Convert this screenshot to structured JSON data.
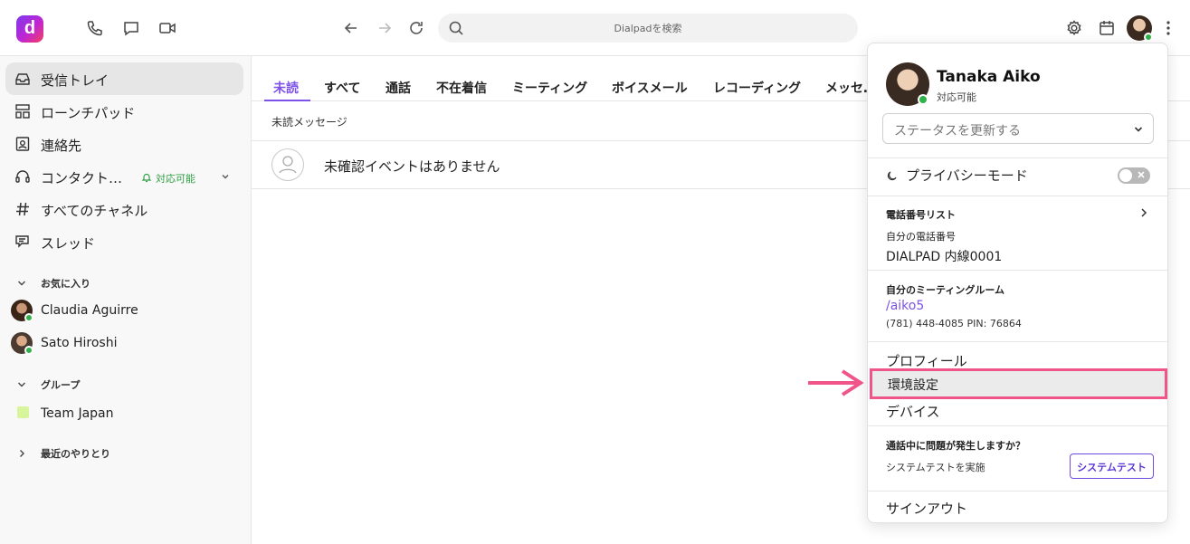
{
  "app": {
    "logo_letter": "d",
    "search_placeholder": "Dialpadを検索"
  },
  "sidebar": {
    "items": [
      {
        "label": "受信トレイ",
        "icon": "inbox-icon"
      },
      {
        "label": "ローンチパッド",
        "icon": "launchpad-icon"
      },
      {
        "label": "連絡先",
        "icon": "contacts-icon"
      },
      {
        "label": "コンタクト…",
        "icon": "headset-icon",
        "status": "対応可能"
      },
      {
        "label": "すべてのチャネル",
        "icon": "hash-icon"
      },
      {
        "label": "スレッド",
        "icon": "thread-icon"
      }
    ],
    "favorites_label": "お気に入り",
    "favorites": [
      {
        "name": "Claudia Aguirre"
      },
      {
        "name": "Sato Hiroshi"
      }
    ],
    "groups_label": "グループ",
    "groups": [
      {
        "name": "Team Japan",
        "color": "#d7f59a"
      }
    ],
    "recent_label": "最近のやりとり"
  },
  "main": {
    "tabs": [
      "未読",
      "すべて",
      "通話",
      "不在着信",
      "ミーティング",
      "ボイスメール",
      "レコーディング",
      "メッセ…"
    ],
    "subheader": "未読メッセージ",
    "empty_text": "未確認イベントはありません"
  },
  "menu": {
    "user_name": "Tanaka Aiko",
    "user_status": "対応可能",
    "status_select_placeholder": "ステータスを更新する",
    "privacy_mode": "プライバシーモード",
    "phone_list_title": "電話番号リスト",
    "my_number_label": "自分の電話番号",
    "my_number_value": "DIALPAD 内線0001",
    "meeting_room_title": "自分のミーティングルーム",
    "meeting_room_link": "/aiko5",
    "meeting_room_dialin": "(781) 448-4085 PIN: 76864",
    "profile": "プロフィール",
    "preferences": "環境設定",
    "devices": "デバイス",
    "call_issue_title": "通話中に問題が発生しますか？",
    "call_issue_text": "システムテストを実施",
    "system_test_button": "システムテスト",
    "sign_out": "サインアウト"
  },
  "colors": {
    "accent": "#7c52e8",
    "online": "#2fb24a",
    "highlight_border": "#f0558a"
  }
}
